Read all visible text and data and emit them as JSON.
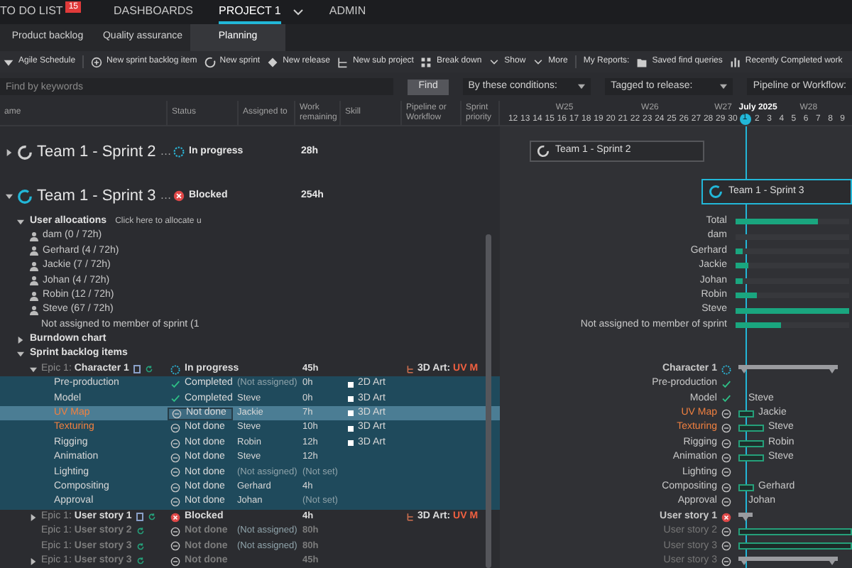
{
  "nav": {
    "items": [
      {
        "label": "TO DO LIST",
        "badge": "15",
        "selected": false
      },
      {
        "label": "DASHBOARDS",
        "selected": false
      },
      {
        "label": "PROJECT 1",
        "selected": true,
        "dropdown": true
      },
      {
        "label": "ADMIN",
        "selected": false
      }
    ]
  },
  "tabs": [
    {
      "label": "Product backlog",
      "selected": false
    },
    {
      "label": "Quality assurance",
      "selected": false
    },
    {
      "label": "Planning",
      "selected": true
    }
  ],
  "toolbar": [
    {
      "kind": "caret",
      "label": "Agile Schedule"
    },
    {
      "kind": "add",
      "label": "New sprint backlog item"
    },
    {
      "kind": "sprint",
      "label": "New sprint"
    },
    {
      "kind": "release",
      "label": "New release"
    },
    {
      "kind": "subproject",
      "label": "New sub project"
    },
    {
      "kind": "breakdown",
      "label": "Break down"
    },
    {
      "kind": "menu",
      "label": "Show"
    },
    {
      "kind": "menu",
      "label": "More"
    },
    {
      "kind": "heading",
      "label": "My Reports:"
    },
    {
      "kind": "folder",
      "label": "Saved find queries"
    },
    {
      "kind": "chart",
      "label": "Recently Completed work"
    }
  ],
  "filters": {
    "search": {
      "placeholder": "Find by keywords"
    },
    "find_button": "Find",
    "dropdowns": [
      "By these conditions:",
      "Tagged to release:",
      "Pipeline or Workflow:"
    ]
  },
  "columns": [
    {
      "label": "ame"
    },
    {
      "label": "Status"
    },
    {
      "label": "Assigned to"
    },
    {
      "label": "Work remaining"
    },
    {
      "label": "Skill"
    },
    {
      "label": "Pipeline or Workflow"
    },
    {
      "label": "Sprint priority"
    }
  ],
  "timeline": {
    "days": [
      {
        "label": "12",
        "selected": false
      },
      {
        "label": "13",
        "selected": false
      },
      {
        "label": "14",
        "selected": false
      },
      {
        "label": "15",
        "selected": false
      },
      {
        "label": "16",
        "week": "W25",
        "selected": false
      },
      {
        "label": "17",
        "selected": false
      },
      {
        "label": "18",
        "selected": false
      },
      {
        "label": "19",
        "selected": false
      },
      {
        "label": "20",
        "selected": false
      },
      {
        "label": "21",
        "selected": false
      },
      {
        "label": "22",
        "selected": false
      },
      {
        "label": "23",
        "week": "W26",
        "selected": false
      },
      {
        "label": "24",
        "selected": false
      },
      {
        "label": "25",
        "selected": false
      },
      {
        "label": "26",
        "selected": false
      },
      {
        "label": "27",
        "selected": false
      },
      {
        "label": "28",
        "selected": false
      },
      {
        "label": "29",
        "week": "W27",
        "selected": false
      },
      {
        "label": "30",
        "selected": false
      },
      {
        "label": "1",
        "week": "July 2025",
        "selected": true
      },
      {
        "label": "2",
        "selected": false
      },
      {
        "label": "3",
        "selected": false
      },
      {
        "label": "4",
        "selected": false
      },
      {
        "label": "5",
        "selected": false
      },
      {
        "label": "6",
        "week": "W28",
        "selected": false
      },
      {
        "label": "7",
        "selected": false
      },
      {
        "label": "8",
        "selected": false
      },
      {
        "label": "9",
        "selected": false
      }
    ]
  },
  "sprints": [
    {
      "name": "Team 1 - Sprint 2",
      "more": "…",
      "status": {
        "kind": "in_progress",
        "label": "In progress"
      },
      "work": "28h",
      "expanded": false,
      "active": false,
      "gantt": {
        "label": "Team 1 - Sprint 2"
      }
    },
    {
      "name": "Team 1 - Sprint 3",
      "more": "…",
      "status": {
        "kind": "blocked",
        "label": "Blocked"
      },
      "work": "254h",
      "expanded": true,
      "active": true,
      "gantt": {
        "label": "Team 1 - Sprint 3"
      },
      "sections": [
        {
          "kind": "allocations",
          "title": "User allocations",
          "hint": "Click here to allocate u",
          "expanded": true,
          "gantt": {
            "label": "Total",
            "level": 0.72
          },
          "users": [
            {
              "kind": "user",
              "label": "dam (0 / 72h)",
              "gantt": {
                "label": "dam"
              }
            },
            {
              "kind": "user",
              "label": "Gerhard (4 / 72h)",
              "gantt": {
                "label": "Gerhard",
                "level": 0.06
              }
            },
            {
              "kind": "user",
              "label": "Jackie (7 / 72h)",
              "gantt": {
                "label": "Jackie",
                "level": 0.11
              }
            },
            {
              "kind": "user",
              "label": "Johan (4 / 72h)",
              "gantt": {
                "label": "Johan",
                "level": 0.06
              }
            },
            {
              "kind": "user",
              "label": "Robin (12 / 72h)",
              "gantt": {
                "label": "Robin",
                "level": 0.19
              }
            },
            {
              "kind": "user",
              "label": "Steve (67 / 72h)",
              "gantt": {
                "label": "Steve",
                "level": 1
              }
            },
            {
              "kind": "unassigned",
              "label": "Not assigned to member of sprint (1",
              "gantt": {
                "label": "Not assigned to member of sprint",
                "level": 0.4
              }
            }
          ]
        },
        {
          "kind": "burndown",
          "title": "Burndown chart",
          "expanded": false
        },
        {
          "kind": "backlog",
          "title": "Sprint backlog items",
          "expanded": true,
          "items": [
            {
              "kind": "epic",
              "prefix": "Epic 1:",
              "name": "Character 1",
              "expanded": true,
              "note": true,
              "dim": false,
              "status": {
                "kind": "in_progress",
                "label": "In progress"
              },
              "work": "45h",
              "pipeline": "3D Art:",
              "pipeline_step": "UV M",
              "gantt": {
                "label": "Character 1",
                "bar": {
                  "kind": "summary"
                }
              },
              "children": [
                {
                  "kind": "task",
                  "name": "Pre-production",
                  "flagged": false,
                  "selected": false,
                  "status": {
                    "kind": "completed",
                    "label": "Completed"
                  },
                  "assigned": "(Not assigned)",
                  "assigned_unset": true,
                  "work": "0h",
                  "skill": "2D Art",
                  "gantt": {
                    "label": "Pre-production"
                  }
                },
                {
                  "kind": "task",
                  "name": "Model",
                  "flagged": false,
                  "selected": false,
                  "status": {
                    "kind": "completed",
                    "label": "Completed"
                  },
                  "assigned": "Steve",
                  "assigned_unset": false,
                  "work": "0h",
                  "skill": "3D Art",
                  "gantt": {
                    "label": "Model",
                    "assignee": "Steve"
                  }
                },
                {
                  "kind": "task",
                  "name": "UV Map",
                  "flagged": true,
                  "selected": true,
                  "status": {
                    "kind": "not_done",
                    "label": "Not done"
                  },
                  "assigned": "Jackie",
                  "assigned_unset": false,
                  "work": "7h",
                  "skill": "3D Art",
                  "gantt": {
                    "label": "UV Map",
                    "bar": {
                      "kind": "short"
                    },
                    "assignee": "Jackie"
                  }
                },
                {
                  "kind": "task",
                  "name": "Texturing",
                  "flagged": true,
                  "selected": false,
                  "status": {
                    "kind": "not_done",
                    "label": "Not done"
                  },
                  "assigned": "Steve",
                  "assigned_unset": false,
                  "work": "10h",
                  "skill": "3D Art",
                  "gantt": {
                    "label": "Texturing",
                    "bar": {
                      "kind": "long"
                    },
                    "assignee": "Steve"
                  }
                },
                {
                  "kind": "task",
                  "name": "Rigging",
                  "flagged": false,
                  "selected": false,
                  "status": {
                    "kind": "not_done",
                    "label": "Not done"
                  },
                  "assigned": "Robin",
                  "assigned_unset": false,
                  "work": "12h",
                  "skill": "3D Art",
                  "gantt": {
                    "label": "Rigging",
                    "bar": {
                      "kind": "long"
                    },
                    "assignee": "Robin"
                  }
                },
                {
                  "kind": "task",
                  "name": "Animation",
                  "flagged": false,
                  "selected": false,
                  "status": {
                    "kind": "not_done",
                    "label": "Not done"
                  },
                  "assigned": "Steve",
                  "assigned_unset": false,
                  "work": "12h",
                  "gantt": {
                    "label": "Animation",
                    "bar": {
                      "kind": "long"
                    },
                    "assignee": "Steve"
                  }
                },
                {
                  "kind": "task",
                  "name": "Lighting",
                  "flagged": false,
                  "selected": false,
                  "status": {
                    "kind": "not_done",
                    "label": "Not done"
                  },
                  "assigned": "(Not assigned)",
                  "assigned_unset": true,
                  "work": "(Not set)",
                  "work_unset": true,
                  "gantt": {
                    "label": "Lighting"
                  }
                },
                {
                  "kind": "task",
                  "name": "Compositing",
                  "flagged": false,
                  "selected": false,
                  "status": {
                    "kind": "not_done",
                    "label": "Not done"
                  },
                  "assigned": "Gerhard",
                  "assigned_unset": false,
                  "work": "4h",
                  "gantt": {
                    "label": "Compositing",
                    "bar": {
                      "kind": "short"
                    },
                    "assignee": "Gerhard"
                  }
                },
                {
                  "kind": "task",
                  "name": "Approval",
                  "flagged": false,
                  "selected": false,
                  "status": {
                    "kind": "not_done",
                    "label": "Not done"
                  },
                  "assigned": "Johan",
                  "assigned_unset": false,
                  "work": "(Not set)",
                  "work_unset": true,
                  "gantt": {
                    "label": "Approval",
                    "assignee": "Johan"
                  }
                }
              ]
            },
            {
              "kind": "epic",
              "prefix": "Epic 1:",
              "name": "User story 1",
              "expanded": false,
              "note": true,
              "dim": false,
              "status": {
                "kind": "blocked",
                "label": "Blocked"
              },
              "work": "4h",
              "pipeline": "3D Art:",
              "pipeline_step": "UV M",
              "gantt": {
                "label": "User story 1",
                "bar": {
                  "kind": "summary_small"
                }
              }
            },
            {
              "kind": "epic",
              "prefix": "Epic 1:",
              "name": "User story 2",
              "note": false,
              "dim": true,
              "status": {
                "kind": "not_done",
                "label": "Not done"
              },
              "assigned": "(Not assigned)",
              "assigned_unset": true,
              "work": "80h",
              "gantt": {
                "label": "User story 2",
                "bar": {
                  "kind": "full"
                }
              }
            },
            {
              "kind": "epic",
              "prefix": "Epic 1:",
              "name": "User story 3",
              "note": false,
              "dim": true,
              "status": {
                "kind": "not_done",
                "label": "Not done"
              },
              "assigned": "(Not assigned)",
              "assigned_unset": true,
              "work": "80h",
              "gantt": {
                "label": "User story 3",
                "bar": {
                  "kind": "full"
                }
              }
            },
            {
              "kind": "epic",
              "prefix": "Epic 1:",
              "name": "User story 3",
              "expanded": false,
              "note": false,
              "dim": true,
              "status": {
                "kind": "not_done",
                "label": "Not done"
              },
              "work": "45h",
              "gantt": {
                "label": "User story 3",
                "bar": {
                  "kind": "summary"
                }
              }
            }
          ]
        }
      ]
    }
  ]
}
